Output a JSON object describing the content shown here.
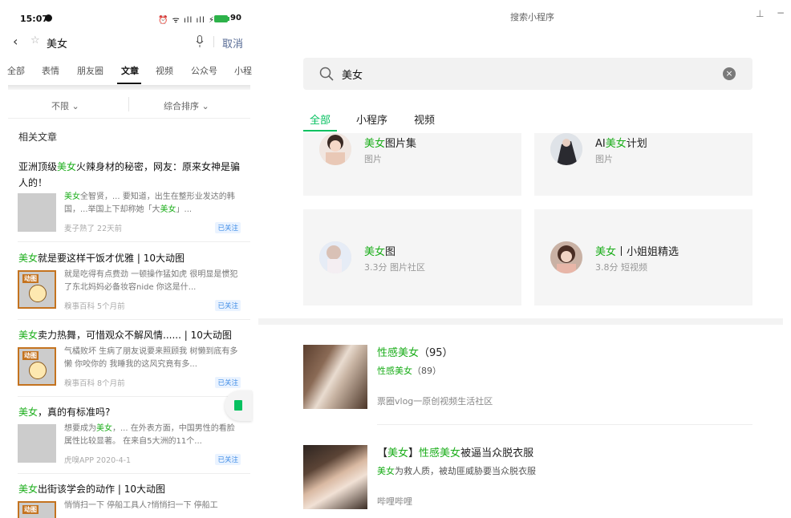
{
  "phone": {
    "status": {
      "time": "15:07",
      "icons": "⏰ ᯤ ıll ıll ⚡",
      "battery": "90"
    },
    "search": {
      "query": "美女",
      "cancel": "取消"
    },
    "tabs": [
      "全部",
      "表情",
      "朋友圈",
      "文章",
      "视频",
      "公众号",
      "小程"
    ],
    "active_tab": "文章",
    "filters": {
      "left": "不限 ⌄",
      "right": "综合排序 ⌄"
    },
    "section_title": "相关文章",
    "articles": [
      {
        "title_pre": "亚洲顶级",
        "title_hl": "美女",
        "title_post": "火辣身材的秘密，网友：原来女神是骗人的！",
        "snippet_hl1": "美女",
        "snippet_a": "全智贤，... 要知道，出生在整形业发达的韩国，...举国上下却称她「大",
        "snippet_hl2": "美女",
        "snippet_b": "」...",
        "meta": "麦子熟了  22天前",
        "badge": "已关注"
      },
      {
        "title_hl": "美女",
        "title_post": "就是要这样干饭才优雅 | 10大动图",
        "snippet": "就是吃得有点费劲 一顿操作猛如虎 很明显是惯犯了东北妈妈必备妆容nide 你这是什...",
        "thumb_label": "动图",
        "meta": "糗事百科  5个月前",
        "badge": "已关注"
      },
      {
        "title_hl": "美女",
        "title_post": "卖力热舞，可惜观众不解风情...... | 10大动图",
        "snippet": "气橘败坏 生病了朋友说要来照顾我 树懒到底有多懒 你咬你的 我睡我的这风究竟有多...",
        "thumb_label": "动图",
        "meta": "糗事百科  8个月前",
        "badge": "已关注"
      },
      {
        "title_hl": "美女",
        "title_post": "，真的有标准吗?",
        "snippet_a": "想要成为",
        "snippet_hl": "美女",
        "snippet_b": "，... 在外表方面，中国男性的看脸属性比较显著。 在来自5大洲的11个...",
        "meta": "虎嗅APP  2020-4-1",
        "badge": "已关注"
      },
      {
        "title_hl": "美女",
        "title_post": "出街该学会的动作 | 10大动图",
        "snippet": "悄悄扫一下 停船工具人?悄悄扫一下 停船工",
        "thumb_label": "动图"
      }
    ]
  },
  "panel": {
    "title": "搜索小程序",
    "pin_icon": "⊥",
    "min_icon": "−",
    "search_value": "美女",
    "tabs": [
      "全部",
      "小程序",
      "视频"
    ],
    "active_tab": "全部",
    "apps": [
      {
        "name_hl": "美女",
        "name_rest": "图片集",
        "sub": "图片"
      },
      {
        "name_pre": "AI",
        "name_hl": "美女",
        "name_rest": "计划",
        "sub": "图片"
      },
      {
        "name_hl": "美女",
        "name_rest": "图",
        "sub": "3.3分  图片社区"
      },
      {
        "name_hl": "美女",
        "name_rest": "丨小姐姐精选",
        "sub": "3.8分  短视频"
      }
    ],
    "videos": [
      {
        "title_hl": "性感美女",
        "title_rest": "（95）",
        "sub_hl": "性感美女",
        "sub_rest": "（89）",
        "source": "票圈vlog一原创视频生活社区"
      },
      {
        "title_a": "【",
        "title_hl1": "美女",
        "title_b": "】",
        "title_hl2": "性感美女",
        "title_c": "被逼当众脱衣服",
        "sub_hl": "美女",
        "sub_rest": "为救人质，被劫匪威胁要当众脱衣服",
        "source": "哔哩哔哩"
      }
    ]
  },
  "colors": {
    "highlight": "#1aad19",
    "accent": "#07c160",
    "link": "#576b95",
    "badge": "#3d8be6"
  }
}
